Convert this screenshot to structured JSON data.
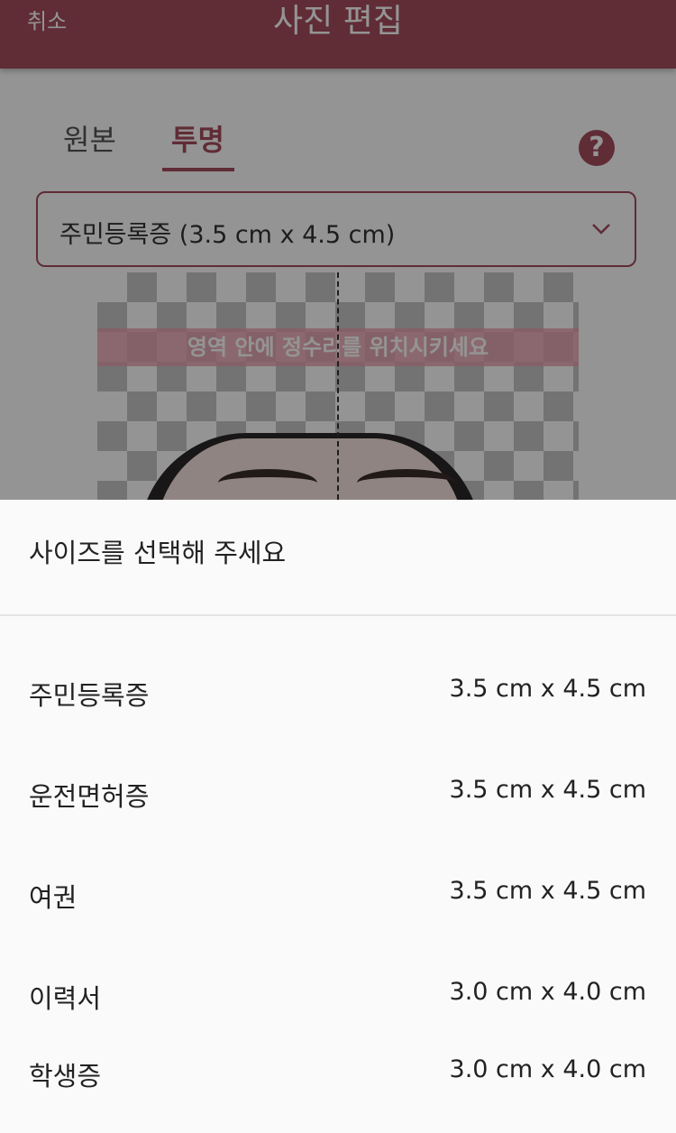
{
  "header": {
    "cancel_label": "취소",
    "title": "사진 편집"
  },
  "tabs": [
    {
      "label": "원본",
      "selected": false
    },
    {
      "label": "투명",
      "selected": true
    }
  ],
  "help_icon": "?",
  "size_select": {
    "value": "주민등록증 (3.5 cm x 4.5 cm)"
  },
  "photo": {
    "guide_text": "영역 안에 정수리를 위치시키세요"
  },
  "sheet": {
    "title": "사이즈를 선택해 주세요",
    "options": [
      {
        "name": "주민등록증",
        "size": "3.5 cm x 4.5 cm"
      },
      {
        "name": "운전면허증",
        "size": "3.5 cm x 4.5 cm"
      },
      {
        "name": "여권",
        "size": "3.5 cm x 4.5 cm"
      },
      {
        "name": "이력서",
        "size": "3.0 cm x 4.0 cm"
      },
      {
        "name": "학생증",
        "size": "3.0 cm x 4.0 cm"
      }
    ]
  },
  "colors": {
    "accent": "#a54d5e",
    "sheet_background": "#fafafa"
  }
}
